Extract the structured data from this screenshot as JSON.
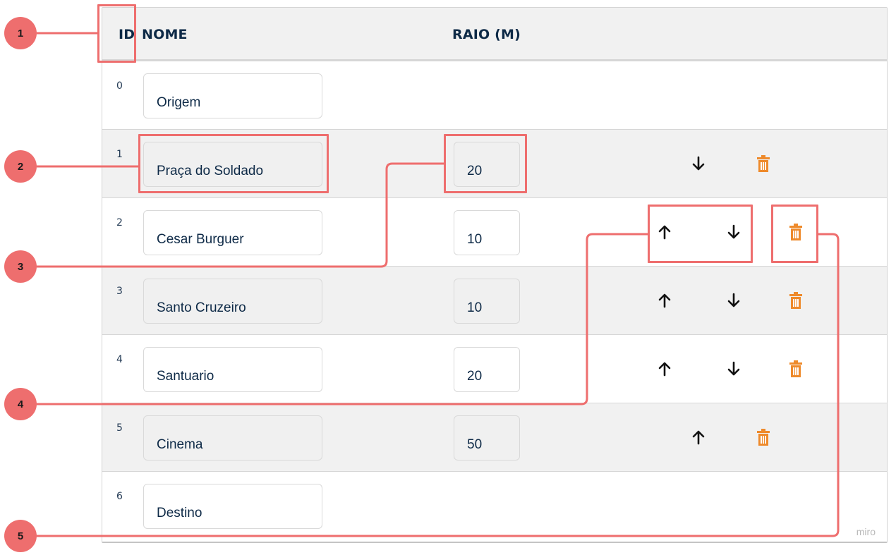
{
  "table": {
    "headers": {
      "id": "ID",
      "nome": "NOME",
      "raio": "RAIO (M)"
    },
    "rows": [
      {
        "id": "0",
        "nome": "Origem",
        "raio": null,
        "actions": []
      },
      {
        "id": "1",
        "nome": "Praça do Soldado",
        "raio": "20",
        "actions": [
          "move-down",
          "delete"
        ]
      },
      {
        "id": "2",
        "nome": "Cesar Burguer",
        "raio": "10",
        "actions": [
          "move-up",
          "move-down",
          "delete"
        ]
      },
      {
        "id": "3",
        "nome": "Santo Cruzeiro",
        "raio": "10",
        "actions": [
          "move-up",
          "move-down",
          "delete"
        ]
      },
      {
        "id": "4",
        "nome": "Santuario",
        "raio": "20",
        "actions": [
          "move-up",
          "move-down",
          "delete"
        ]
      },
      {
        "id": "5",
        "nome": "Cinema",
        "raio": "50",
        "actions": [
          "move-up",
          "delete"
        ]
      },
      {
        "id": "6",
        "nome": "Destino",
        "raio": null,
        "actions": []
      }
    ]
  },
  "callouts": [
    "1",
    "2",
    "3",
    "4",
    "5"
  ],
  "watermark": "miro",
  "colors": {
    "header_text": "#0e2a47",
    "row_alt_bg": "#f1f1f1",
    "delete_icon": "#ee8a2b",
    "arrow_icon": "#111111",
    "annotation": "#ee6e6e"
  },
  "icons": {
    "up": "arrow-up-icon",
    "down": "arrow-down-icon",
    "delete": "trash-icon"
  }
}
